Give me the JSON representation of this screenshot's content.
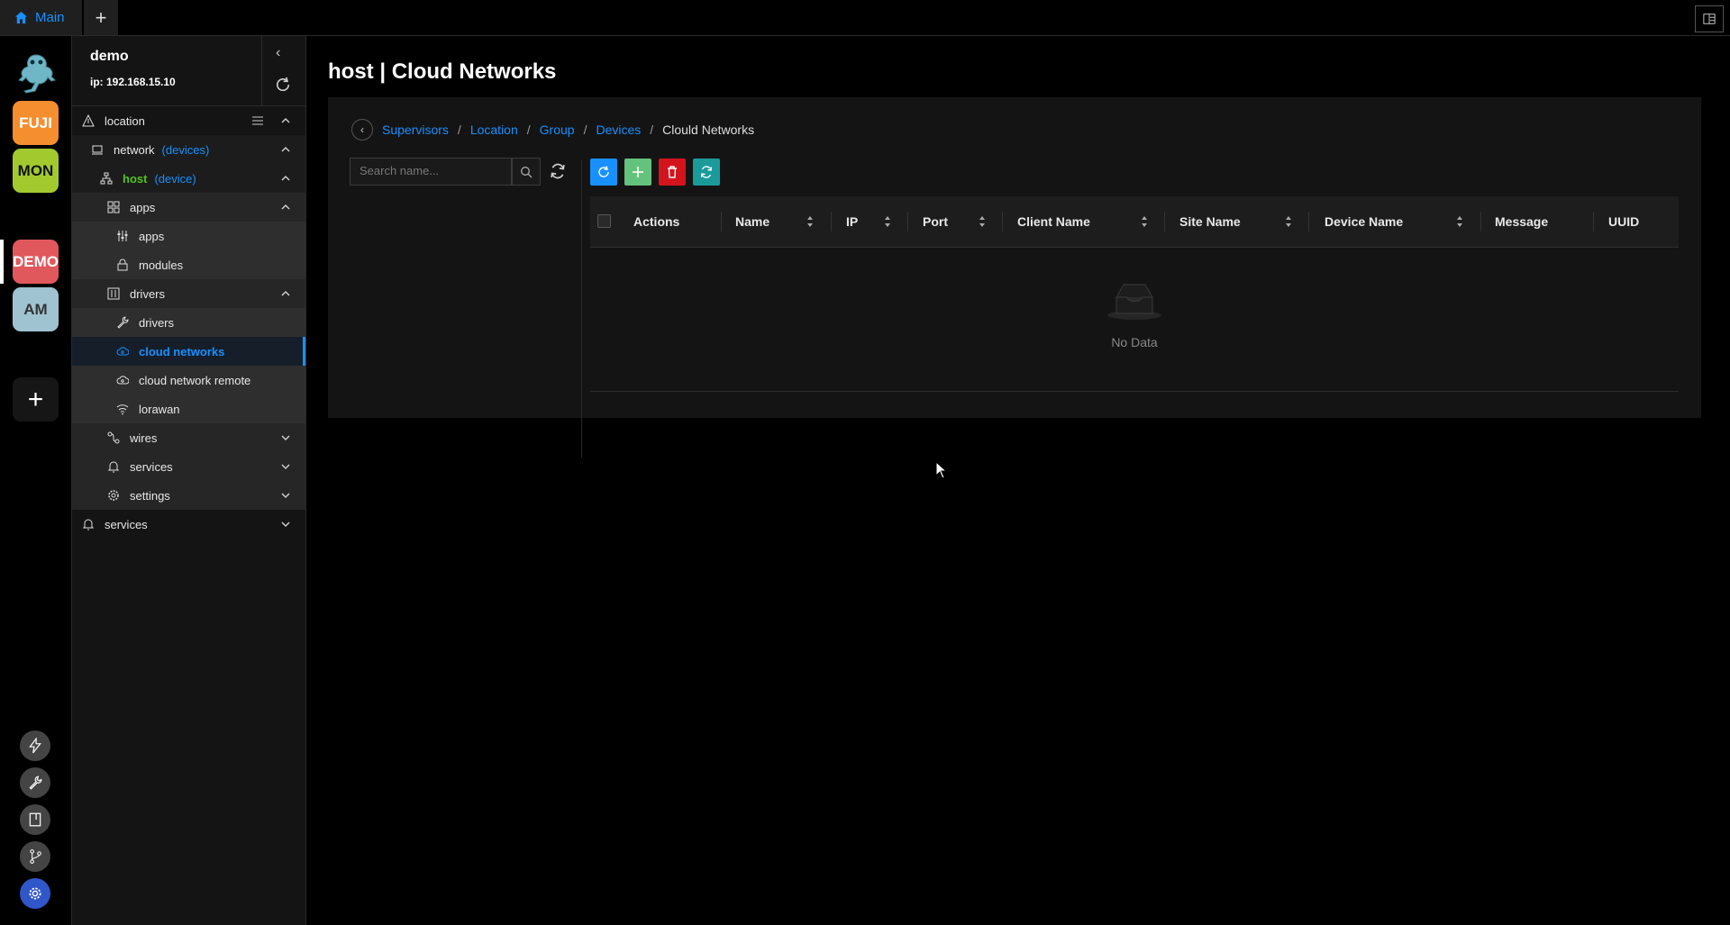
{
  "tabs": {
    "main": "Main"
  },
  "workspaces": [
    {
      "label": "FUJI",
      "bg": "#f58e2e",
      "fg": "#fff"
    },
    {
      "label": "MON",
      "bg": "#a2c92e",
      "fg": "#111"
    },
    {
      "label": "DEMO",
      "bg": "#e0585c",
      "fg": "#fff"
    },
    {
      "label": "AM",
      "bg": "#9fc3d0",
      "fg": "#333"
    }
  ],
  "sidebar": {
    "name": "demo",
    "ip": "ip: 192.168.15.10",
    "tree": {
      "location": "location",
      "network": "network",
      "network_tag": "(devices)",
      "host": "host",
      "host_tag": "(device)",
      "apps_group": "apps",
      "apps": "apps",
      "modules": "modules",
      "drivers_group": "drivers",
      "drivers": "drivers",
      "cloud_networks": "cloud networks",
      "cloud_network_remote": "cloud network remote",
      "lorawan": "lorawan",
      "wires": "wires",
      "services_inner": "services",
      "settings": "settings",
      "services": "services"
    }
  },
  "page": {
    "title": "host | Cloud Networks",
    "breadcrumb": [
      "Supervisors",
      "Location",
      "Group",
      "Devices",
      "Clould Networks"
    ],
    "search_placeholder": "Search name...",
    "columns": [
      "Actions",
      "Name",
      "IP",
      "Port",
      "Client Name",
      "Site Name",
      "Device Name",
      "Message",
      "UUID"
    ],
    "empty_text": "No Data"
  },
  "colors": {
    "accent": "#1890ff",
    "button_refresh": "#1890ff",
    "button_add": "#63c27b",
    "button_delete": "#d4141c",
    "button_sync": "#1b9a9a"
  }
}
